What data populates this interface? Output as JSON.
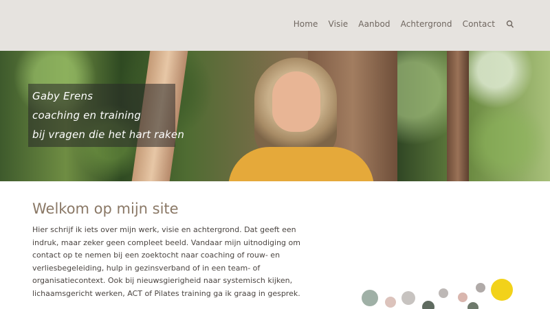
{
  "nav": {
    "items": [
      "Home",
      "Visie",
      "Aanbod",
      "Achtergrond",
      "Contact"
    ],
    "search_icon": "search-icon"
  },
  "hero": {
    "lines": [
      "Gaby Erens",
      "coaching en training",
      "bij vragen die het hart raken"
    ]
  },
  "content": {
    "title": "Welkom op mijn site",
    "body": "Hier schrijf ik iets over mijn werk, visie en achtergrond. Dat geeft een indruk, maar zeker geen compleet beeld. Vandaar mijn uitnodiging om contact op te nemen bij een zoektocht naar coaching of rouw- en verliesbegeleiding, hulp in gezinsverband of in een team- of organisatiecontext. Ook bij nieuwsgierigheid naar systemisch kijken, lichaamsgericht werken, ACT of Pilates training ga ik graag in gesprek."
  },
  "colors": {
    "header_bg": "#e6e3df",
    "nav_text": "#6f665f",
    "title": "#8a7866",
    "accent_yellow": "#f2d21a"
  }
}
